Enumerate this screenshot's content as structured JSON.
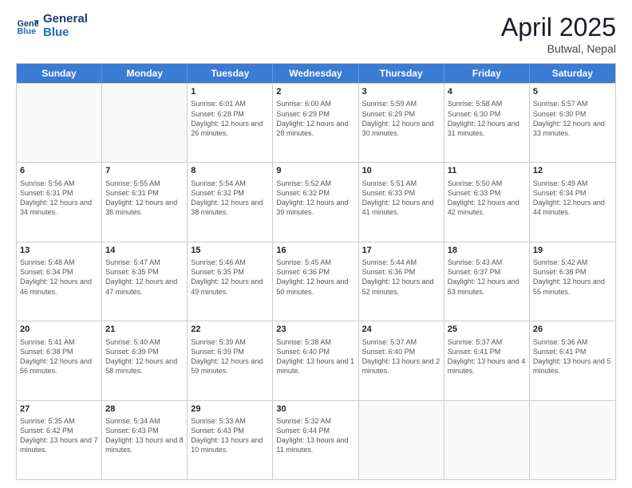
{
  "logo": {
    "line1": "General",
    "line2": "Blue"
  },
  "title": "April 2025",
  "subtitle": "Butwal, Nepal",
  "header_days": [
    "Sunday",
    "Monday",
    "Tuesday",
    "Wednesday",
    "Thursday",
    "Friday",
    "Saturday"
  ],
  "weeks": [
    [
      {
        "day": "",
        "sunrise": "",
        "sunset": "",
        "daylight": ""
      },
      {
        "day": "",
        "sunrise": "",
        "sunset": "",
        "daylight": ""
      },
      {
        "day": "1",
        "sunrise": "Sunrise: 6:01 AM",
        "sunset": "Sunset: 6:28 PM",
        "daylight": "Daylight: 12 hours and 26 minutes."
      },
      {
        "day": "2",
        "sunrise": "Sunrise: 6:00 AM",
        "sunset": "Sunset: 6:29 PM",
        "daylight": "Daylight: 12 hours and 28 minutes."
      },
      {
        "day": "3",
        "sunrise": "Sunrise: 5:59 AM",
        "sunset": "Sunset: 6:29 PM",
        "daylight": "Daylight: 12 hours and 30 minutes."
      },
      {
        "day": "4",
        "sunrise": "Sunrise: 5:58 AM",
        "sunset": "Sunset: 6:30 PM",
        "daylight": "Daylight: 12 hours and 31 minutes."
      },
      {
        "day": "5",
        "sunrise": "Sunrise: 5:57 AM",
        "sunset": "Sunset: 6:30 PM",
        "daylight": "Daylight: 12 hours and 33 minutes."
      }
    ],
    [
      {
        "day": "6",
        "sunrise": "Sunrise: 5:56 AM",
        "sunset": "Sunset: 6:31 PM",
        "daylight": "Daylight: 12 hours and 34 minutes."
      },
      {
        "day": "7",
        "sunrise": "Sunrise: 5:55 AM",
        "sunset": "Sunset: 6:31 PM",
        "daylight": "Daylight: 12 hours and 36 minutes."
      },
      {
        "day": "8",
        "sunrise": "Sunrise: 5:54 AM",
        "sunset": "Sunset: 6:32 PM",
        "daylight": "Daylight: 12 hours and 38 minutes."
      },
      {
        "day": "9",
        "sunrise": "Sunrise: 5:52 AM",
        "sunset": "Sunset: 6:32 PM",
        "daylight": "Daylight: 12 hours and 39 minutes."
      },
      {
        "day": "10",
        "sunrise": "Sunrise: 5:51 AM",
        "sunset": "Sunset: 6:33 PM",
        "daylight": "Daylight: 12 hours and 41 minutes."
      },
      {
        "day": "11",
        "sunrise": "Sunrise: 5:50 AM",
        "sunset": "Sunset: 6:33 PM",
        "daylight": "Daylight: 12 hours and 42 minutes."
      },
      {
        "day": "12",
        "sunrise": "Sunrise: 5:49 AM",
        "sunset": "Sunset: 6:34 PM",
        "daylight": "Daylight: 12 hours and 44 minutes."
      }
    ],
    [
      {
        "day": "13",
        "sunrise": "Sunrise: 5:48 AM",
        "sunset": "Sunset: 6:34 PM",
        "daylight": "Daylight: 12 hours and 46 minutes."
      },
      {
        "day": "14",
        "sunrise": "Sunrise: 5:47 AM",
        "sunset": "Sunset: 6:35 PM",
        "daylight": "Daylight: 12 hours and 47 minutes."
      },
      {
        "day": "15",
        "sunrise": "Sunrise: 5:46 AM",
        "sunset": "Sunset: 6:35 PM",
        "daylight": "Daylight: 12 hours and 49 minutes."
      },
      {
        "day": "16",
        "sunrise": "Sunrise: 5:45 AM",
        "sunset": "Sunset: 6:36 PM",
        "daylight": "Daylight: 12 hours and 50 minutes."
      },
      {
        "day": "17",
        "sunrise": "Sunrise: 5:44 AM",
        "sunset": "Sunset: 6:36 PM",
        "daylight": "Daylight: 12 hours and 52 minutes."
      },
      {
        "day": "18",
        "sunrise": "Sunrise: 5:43 AM",
        "sunset": "Sunset: 6:37 PM",
        "daylight": "Daylight: 12 hours and 53 minutes."
      },
      {
        "day": "19",
        "sunrise": "Sunrise: 5:42 AM",
        "sunset": "Sunset: 6:38 PM",
        "daylight": "Daylight: 12 hours and 55 minutes."
      }
    ],
    [
      {
        "day": "20",
        "sunrise": "Sunrise: 5:41 AM",
        "sunset": "Sunset: 6:38 PM",
        "daylight": "Daylight: 12 hours and 56 minutes."
      },
      {
        "day": "21",
        "sunrise": "Sunrise: 5:40 AM",
        "sunset": "Sunset: 6:39 PM",
        "daylight": "Daylight: 12 hours and 58 minutes."
      },
      {
        "day": "22",
        "sunrise": "Sunrise: 5:39 AM",
        "sunset": "Sunset: 6:39 PM",
        "daylight": "Daylight: 12 hours and 59 minutes."
      },
      {
        "day": "23",
        "sunrise": "Sunrise: 5:38 AM",
        "sunset": "Sunset: 6:40 PM",
        "daylight": "Daylight: 13 hours and 1 minute."
      },
      {
        "day": "24",
        "sunrise": "Sunrise: 5:37 AM",
        "sunset": "Sunset: 6:40 PM",
        "daylight": "Daylight: 13 hours and 2 minutes."
      },
      {
        "day": "25",
        "sunrise": "Sunrise: 5:37 AM",
        "sunset": "Sunset: 6:41 PM",
        "daylight": "Daylight: 13 hours and 4 minutes."
      },
      {
        "day": "26",
        "sunrise": "Sunrise: 5:36 AM",
        "sunset": "Sunset: 6:41 PM",
        "daylight": "Daylight: 13 hours and 5 minutes."
      }
    ],
    [
      {
        "day": "27",
        "sunrise": "Sunrise: 5:35 AM",
        "sunset": "Sunset: 6:42 PM",
        "daylight": "Daylight: 13 hours and 7 minutes."
      },
      {
        "day": "28",
        "sunrise": "Sunrise: 5:34 AM",
        "sunset": "Sunset: 6:43 PM",
        "daylight": "Daylight: 13 hours and 8 minutes."
      },
      {
        "day": "29",
        "sunrise": "Sunrise: 5:33 AM",
        "sunset": "Sunset: 6:43 PM",
        "daylight": "Daylight: 13 hours and 10 minutes."
      },
      {
        "day": "30",
        "sunrise": "Sunrise: 5:32 AM",
        "sunset": "Sunset: 6:44 PM",
        "daylight": "Daylight: 13 hours and 11 minutes."
      },
      {
        "day": "",
        "sunrise": "",
        "sunset": "",
        "daylight": ""
      },
      {
        "day": "",
        "sunrise": "",
        "sunset": "",
        "daylight": ""
      },
      {
        "day": "",
        "sunrise": "",
        "sunset": "",
        "daylight": ""
      }
    ]
  ]
}
